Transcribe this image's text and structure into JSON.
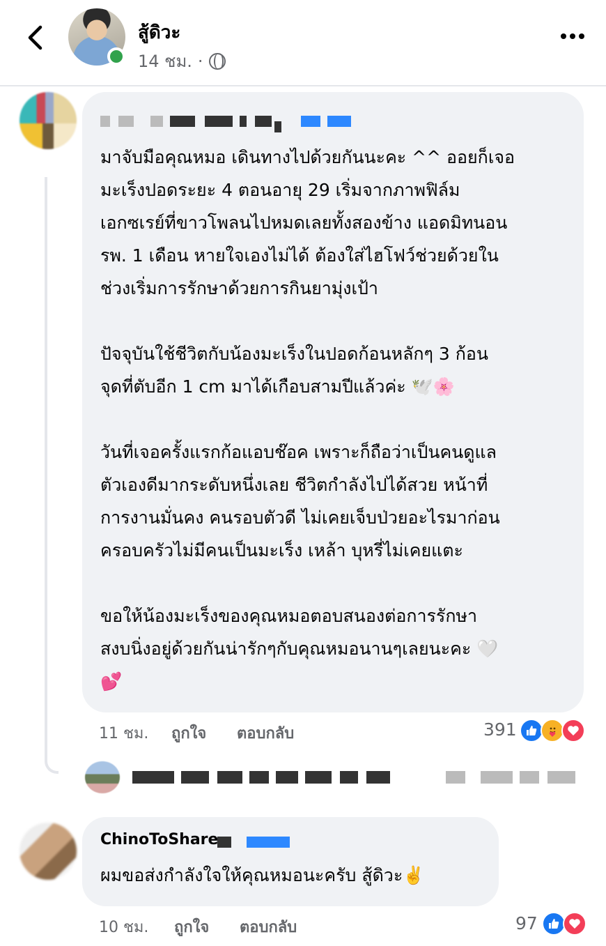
{
  "header": {
    "page_name": "สู้ดิวะ",
    "time": "14 ชม.",
    "separator": "·"
  },
  "comment1": {
    "text": "มาจับมือคุณหมอ เดินทางไปด้วยกันนะคะ ^^ ออยก็เจอ\nมะเร็งปอดระยะ 4 ตอนอายุ 29 เริ่มจากภาพฟิล์ม\nเอกซเรย์ที่ขาวโพลนไปหมดเลยทั้งสองข้าง แอดมิทนอน\nรพ. 1 เดือน หายใจเองไม่ได้ ต้องใส่ไฮโฟว์ช่วยด้วยใน\nช่วงเริ่มการรักษาด้วยการกินยามุ่งเป้า\n\nปัจจุบันใช้ชีวิตกับน้องมะเร็งในปอดก้อนหลักๆ 3 ก้อน\nจุดที่ตับอีก 1 cm มาได้เกือบสามปีแล้วค่ะ 🕊️🌸\n\nวันที่เจอครั้งแรกก้อแอบช๊อค เพราะก็ถือว่าเป็นคนดูแล\nตัวเองดีมากระดับหนึ่งเลย ชีวิตกำลังไปได้สวย หน้าที่\nการงานมั่นคง คนรอบตัวดี ไม่เคยเจ็บป่วยอะไรมาก่อน\nครอบครัวไม่มีคนเป็นมะเร็ง เหล้า บุหรี่ไม่เคยแตะ\n\nขอให้น้องมะเร็งของคุณหมอตอบสนองต่อการรักษา\nสงบนิ่งอยู่ด้วยกันน่ารักๆกับคุณหมอนานๆเลยนะคะ 🤍\n💕",
    "time": "11 ชม.",
    "like_label": "ถูกใจ",
    "reply_label": "ตอบกลับ",
    "reaction_count": "391",
    "reactions": [
      "like-icon",
      "care-icon",
      "love-icon"
    ]
  },
  "comment2": {
    "author": "ChinoToShare",
    "text": "ผมขอส่งกำลังใจให้คุณหมอนะครับ  สู้ดิวะ✌️",
    "time": "10 ชม.",
    "like_label": "ถูกใจ",
    "reply_label": "ตอบกลับ",
    "reaction_count": "97",
    "reactions": [
      "like-icon",
      "love-icon"
    ]
  },
  "colors": {
    "bubble": "#f0f2f5",
    "secondary_text": "#65676b",
    "like_blue": "#1877f2",
    "love_red": "#f33e58",
    "online_green": "#31a24c"
  }
}
